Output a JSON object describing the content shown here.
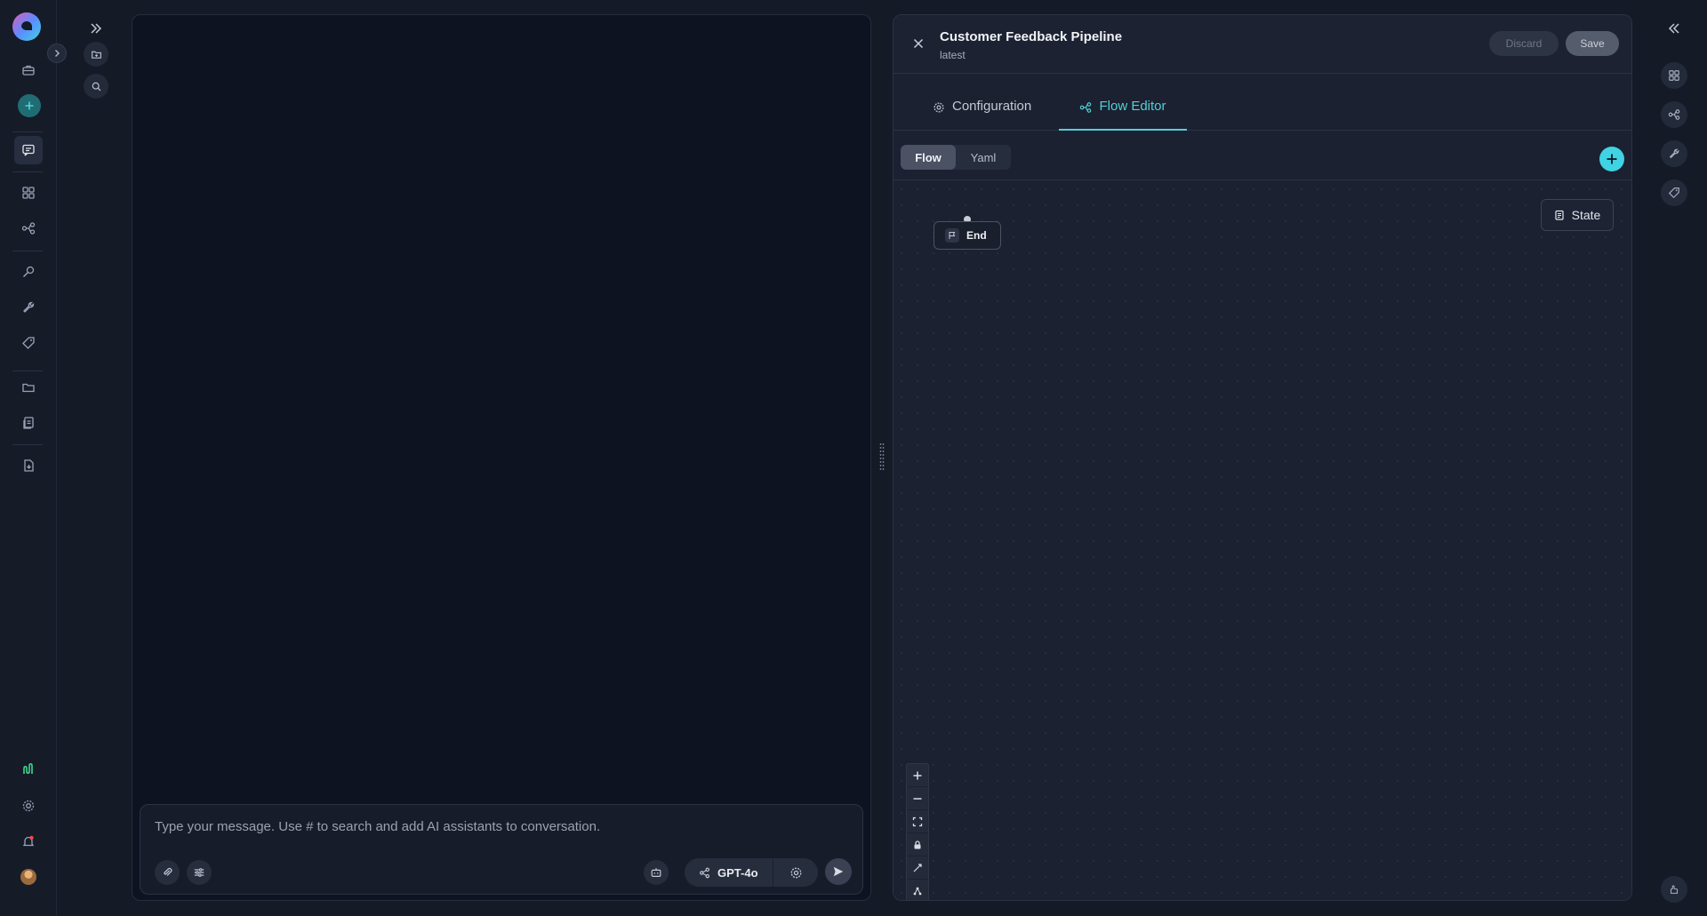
{
  "rail": {
    "items": [
      {
        "name": "app-logo"
      },
      {
        "name": "toggle-sidebar"
      },
      {
        "name": "briefcase-icon"
      },
      {
        "name": "new-chat-plus-icon"
      },
      {
        "name": "chat-icon"
      },
      {
        "name": "grid-icon"
      },
      {
        "name": "workflow-icon"
      },
      {
        "name": "search-key-icon"
      },
      {
        "name": "wrench-icon"
      },
      {
        "name": "tags-icon"
      },
      {
        "name": "folder-icon"
      },
      {
        "name": "documents-icon"
      },
      {
        "name": "file-export-icon"
      },
      {
        "name": "analytics-icon"
      },
      {
        "name": "settings-icon"
      },
      {
        "name": "notifications-icon"
      },
      {
        "name": "user-avatar"
      }
    ]
  },
  "subcol": {
    "expand_icon": "double-chevron-right-icon",
    "folder_icon": "folder-add-icon",
    "search_icon": "search-icon"
  },
  "chat": {
    "placeholder": "Type your message. Use # to search and add AI assistants to conversation.",
    "model": "GPT-4o"
  },
  "editor": {
    "title": "Customer Feedback Pipeline",
    "version": "latest",
    "discard_label": "Discard",
    "save_label": "Save",
    "tabs": [
      {
        "label": "Configuration",
        "active": false
      },
      {
        "label": "Flow Editor",
        "active": true
      }
    ],
    "view_modes": [
      {
        "label": "Flow",
        "active": true
      },
      {
        "label": "Yaml",
        "active": false
      }
    ],
    "state_label": "State",
    "nodes": [
      {
        "label": "End",
        "icon": "flag-icon"
      }
    ],
    "accent": "#3fd3e3"
  }
}
